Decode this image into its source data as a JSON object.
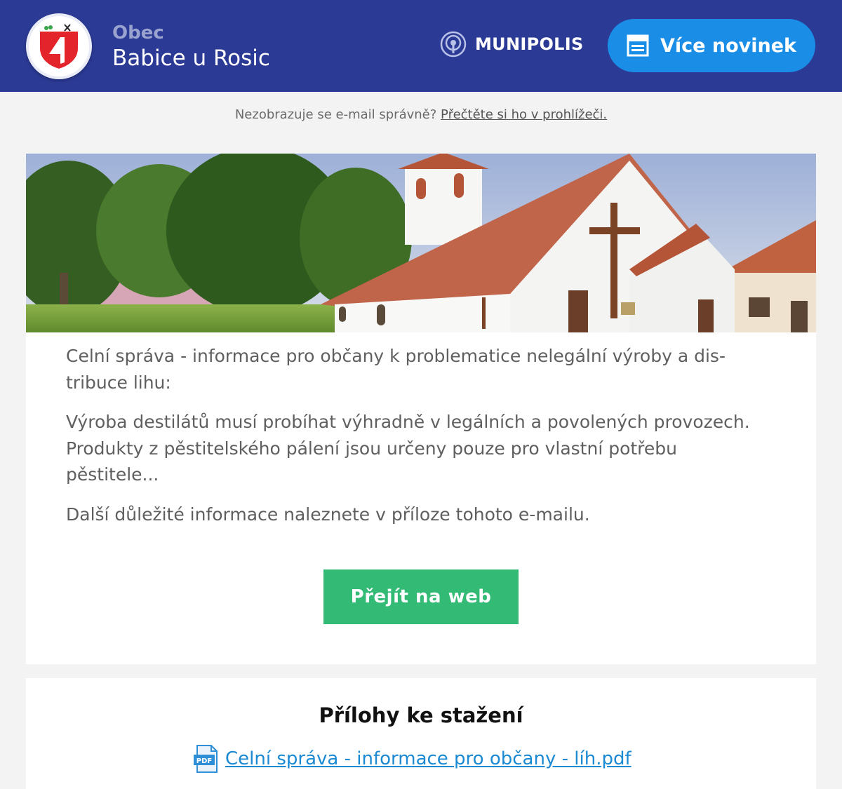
{
  "header": {
    "label": "Obec",
    "municipality": "Babice u Rosic",
    "brand": "MUNIPOLIS",
    "more_news_label": "Více novinek"
  },
  "notice": {
    "text": "Nezobrazuje se e-mail správně?",
    "link": "Přečtěte si ho v prohlížeči."
  },
  "article": {
    "paragraphs": [
      "Celní správa - informace pro občany k problematice nelegální výroby a dis­tribuce lihu:",
      "Výroba destilátů musí probíhat výhradně v legálních a povolených provo­zech. Produkty z pěstitelského pálení jsou určeny pouze pro vlastní potřebu pěstitele...",
      "Další důležité informace naleznete v příloze tohoto e-mailu."
    ],
    "cta_label": "Přejít na web"
  },
  "attachments": {
    "title": "Přílohy ke stažení",
    "files": [
      {
        "name": "Celní správa - informace pro občany - líh.pdf",
        "icon": "pdf-file-icon"
      }
    ]
  },
  "colors": {
    "header_bg": "#2b3a94",
    "button_blue": "#1a8de6",
    "button_green": "#33bb76",
    "link_blue": "#1b8ad3"
  }
}
